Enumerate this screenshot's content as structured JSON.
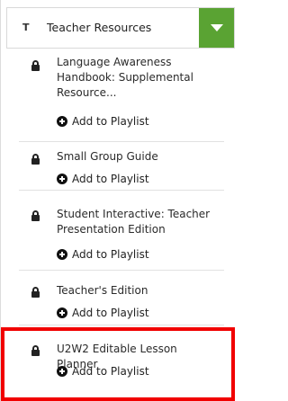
{
  "header": {
    "type_letter": "T",
    "title": "Teacher Resources",
    "accent_color": "#5aa333"
  },
  "items": [
    {
      "title": "Language Awareness Handbook: Supplemental Resource...",
      "action": "Add to Playlist"
    },
    {
      "title": "Small Group Guide",
      "action": "Add to Playlist"
    },
    {
      "title": "Student Interactive: Teacher Presentation Edition",
      "action": "Add to Playlist"
    },
    {
      "title": "Teacher's Edition",
      "action": "Add to Playlist"
    },
    {
      "title": "U2W2 Editable Lesson Planner",
      "action": "Add to Playlist",
      "highlighted": true
    }
  ],
  "highlight_color": "#f10000"
}
